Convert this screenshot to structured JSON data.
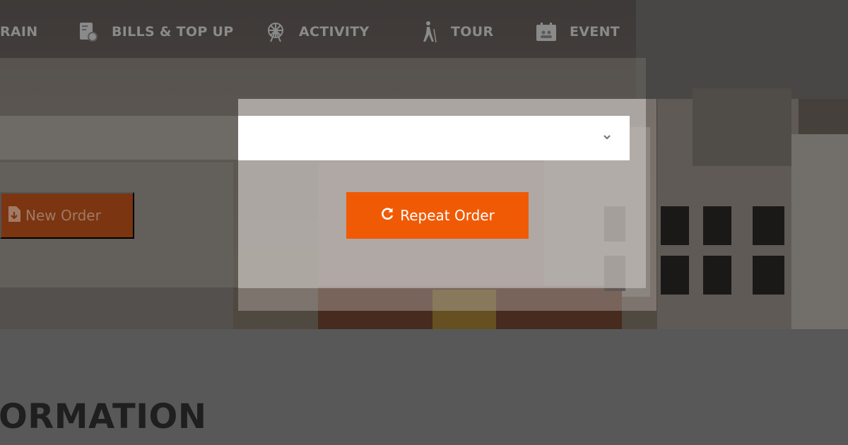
{
  "nav": {
    "items": [
      {
        "label": "RAIN",
        "icon": "train-icon"
      },
      {
        "label": "BILLS & TOP UP",
        "icon": "bill-icon"
      },
      {
        "label": "ACTIVITY",
        "icon": "ferris-wheel-icon"
      },
      {
        "label": "TOUR",
        "icon": "hiker-icon"
      },
      {
        "label": "EVENT",
        "icon": "calendar-icon"
      }
    ]
  },
  "order": {
    "new_order_label": "New Order",
    "repeat_order_label": "Repeat Order",
    "select_value": ""
  },
  "section": {
    "title": "ORMATION"
  },
  "colors": {
    "accent": "#f15a05",
    "accent_dimmed": "#7b3510",
    "nav_text": "#8a8a8a"
  }
}
